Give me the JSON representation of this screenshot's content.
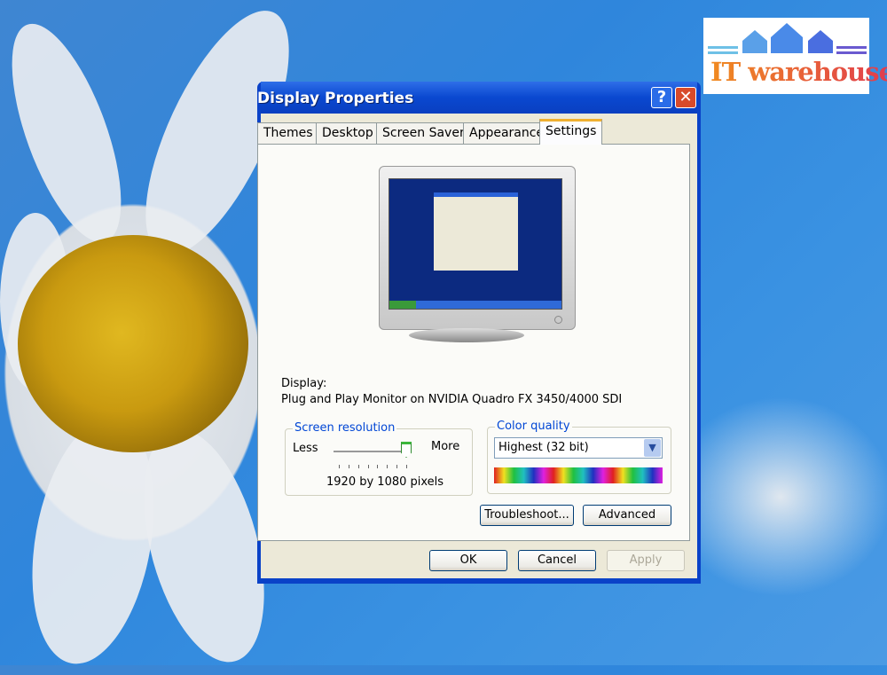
{
  "logo": {
    "text": "IT warehouse"
  },
  "dialog": {
    "title": "Display Properties",
    "help_icon": "question-icon",
    "close_icon": "close-icon",
    "tabs": [
      {
        "label": "Themes"
      },
      {
        "label": "Desktop"
      },
      {
        "label": "Screen Saver"
      },
      {
        "label": "Appearance"
      },
      {
        "label": "Settings",
        "active": true
      }
    ],
    "display_label": "Display:",
    "display_value": "Plug and Play Monitor on NVIDIA Quadro FX 3450/4000 SDI",
    "resolution": {
      "title": "Screen resolution",
      "less": "Less",
      "more": "More",
      "value_text": "1920 by 1080 pixels",
      "slider_position": 1.0,
      "tick_count": 8
    },
    "color_quality": {
      "title": "Color quality",
      "selected": "Highest (32 bit)"
    },
    "buttons": {
      "troubleshoot": "Troubleshoot...",
      "advanced": "Advanced",
      "ok": "OK",
      "cancel": "Cancel",
      "apply": "Apply"
    },
    "colors": {
      "title_bar": "#0a48d0",
      "dialog_bg": "#ece9d8",
      "group_title": "#0046d5"
    }
  }
}
